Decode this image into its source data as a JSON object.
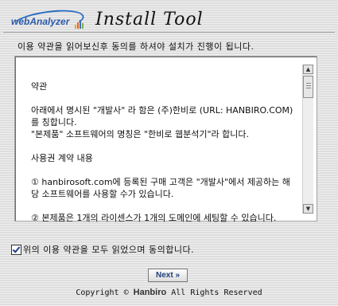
{
  "header": {
    "logo_text": "webAnalyzer",
    "title": "Install Tool"
  },
  "intro_text": "이용 약관을 읽어보신후 동의를 하셔야 설치가 진행이 됩니다.",
  "terms": {
    "heading": "약관",
    "para1": "아래에서 명시된 \"개발사\" 라 함은 (주)한비로 (URL: HANBIRO.COM) 를 칭합니다.",
    "para2": "\"본제품\" 소프트웨어의 명칭은 \"한비로 웹분석기\"라 합니다.",
    "section": "사용권 계약 내용",
    "item1": "① hanbirosoft.com에 등록된 구매 고객은 \"개발사\"에서 제공하는 해당 소프트웨어를 사용할 수가 있습니다.",
    "item2": "② 본제품은 1개의 라이센스가 1개의 도메인에 세팅할 수 있습니다."
  },
  "agree": {
    "label": "위의 이용 약관을 모두 읽었으며 동의합니다.",
    "checked": true
  },
  "next_button": "Next »",
  "footer": {
    "copyright": "Copyright ©",
    "brand": "Hanbiro",
    "rights": "All Rights Reserved"
  },
  "colors": {
    "logo_blue": "#2b5ba8",
    "button_text": "#1d3f7a",
    "bar_colors": [
      "#f2a900",
      "#e6632b",
      "#3d6fc1",
      "#7cb342"
    ]
  },
  "icons": {
    "scroll_up": "▲",
    "scroll_down": "▼"
  }
}
